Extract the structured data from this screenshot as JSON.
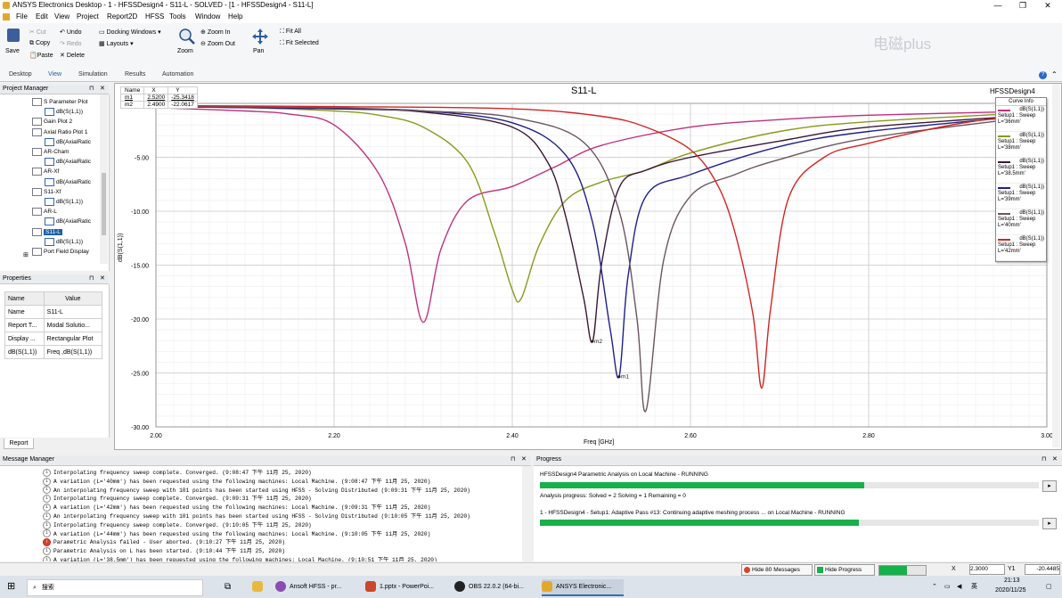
{
  "window": {
    "title": "ANSYS Electronics Desktop - 1 - HFSSDesign4 - S11-L - SOLVED - [1 - HFSSDesign4 - S11-L]"
  },
  "menu": [
    "File",
    "Edit",
    "View",
    "Project",
    "Report2D",
    "HFSS",
    "Tools",
    "Window",
    "Help"
  ],
  "ribbon": {
    "save": "Save",
    "cut": "Cut",
    "copy": "Copy",
    "paste": "Paste",
    "undo": "Undo",
    "redo": "Redo",
    "delete": "Delete",
    "docking": "Docking Windows",
    "layouts": "Layouts",
    "zoom": "Zoom",
    "zoom_in": "Zoom In",
    "zoom_out": "Zoom Out",
    "pan": "Pan",
    "fit_all": "Fit All",
    "fit_selected": "Fit Selected",
    "watermark": "电磁plus"
  },
  "ribbon_tabs": [
    "Desktop",
    "View",
    "Simulation",
    "Results",
    "Automation"
  ],
  "project_manager": {
    "title": "Project Manager",
    "items": [
      {
        "label": "S Parameter Plot",
        "level": 0
      },
      {
        "label": "dB(S(1,1))",
        "level": 1
      },
      {
        "label": "Gain Plot 2",
        "level": 0
      },
      {
        "label": "Axial Ratio Plot 1",
        "level": 0
      },
      {
        "label": "dB(AxialRatic",
        "level": 1
      },
      {
        "label": "AR-Cham",
        "level": 0
      },
      {
        "label": "dB(AxialRatic",
        "level": 1
      },
      {
        "label": "AR-Xf",
        "level": 0
      },
      {
        "label": "dB(AxialRatic",
        "level": 1
      },
      {
        "label": "S11-Xf",
        "level": 0
      },
      {
        "label": "dB(S(1,1))",
        "level": 1
      },
      {
        "label": "AR-L",
        "level": 0
      },
      {
        "label": "dB(AxialRatic",
        "level": 1
      },
      {
        "label": "S11-L",
        "level": 0,
        "selected": true
      },
      {
        "label": "dB(S(1,1))",
        "level": 1
      },
      {
        "label": "Port Field Display",
        "level": 0
      }
    ]
  },
  "properties": {
    "title": "Properties",
    "header": [
      "Name",
      "Value"
    ],
    "rows": [
      [
        "Name",
        "S11-L"
      ],
      [
        "Report T...",
        "Modal Solutio..."
      ],
      [
        "Display ...",
        "Rectangular Plot"
      ],
      [
        "dB(S(1,1))",
        "Freq ,dB(S(1,1))"
      ]
    ],
    "tab": "Report"
  },
  "plot": {
    "title": "S11-L",
    "design": "HFSSDesign4",
    "marker_header": [
      "Name",
      "X",
      "Y"
    ],
    "markers": [
      [
        "m1",
        "2.5200",
        "-25.3418"
      ],
      [
        "m2",
        "2.4900",
        "-22.0617"
      ]
    ],
    "curve_info_title": "Curve Info",
    "legend": [
      {
        "l1": "dB(S(1,1))",
        "l2": "Setup1 : Sweep",
        "l3": "L='36mm'",
        "color": "#c0307f"
      },
      {
        "l1": "dB(S(1,1))",
        "l2": "Setup1 : Sweep",
        "l3": "L='38mm'",
        "color": "#8a9a1a"
      },
      {
        "l1": "dB(S(1,1))",
        "l2": "Setup1 : Sweep",
        "l3": "L='38.5mm'",
        "color": "#3a1836"
      },
      {
        "l1": "dB(S(1,1))",
        "l2": "Setup1 : Sweep",
        "l3": "L='39mm'",
        "color": "#1f1f8c"
      },
      {
        "l1": "dB(S(1,1))",
        "l2": "Setup1 : Sweep",
        "l3": "L='40mm'",
        "color": "#6b5560"
      },
      {
        "l1": "dB(S(1,1))",
        "l2": "Setup1 : Sweep",
        "l3": "L='42mm'",
        "color": "#d42424"
      }
    ]
  },
  "chart_data": {
    "type": "line",
    "title": "S11-L",
    "xlabel": "Freq [GHz]",
    "ylabel": "dB(S(1,1))",
    "xlim": [
      2.0,
      3.0
    ],
    "ylim": [
      -30,
      0
    ],
    "xticks": [
      "2.00",
      "2.20",
      "2.40",
      "2.60",
      "2.80",
      "3.00"
    ],
    "yticks": [
      "-5.00",
      "-10.00",
      "-15.00",
      "-20.00",
      "-25.00",
      "-30.00"
    ],
    "grid": true,
    "series": [
      {
        "name": "L='36mm'",
        "color": "#c0307f",
        "x": [
          2.0,
          2.1,
          2.15,
          2.2,
          2.25,
          2.28,
          2.3,
          2.32,
          2.35,
          2.4,
          2.45,
          2.5,
          2.6,
          2.7,
          2.8,
          3.0
        ],
        "y": [
          -0.4,
          -0.7,
          -1.0,
          -2.0,
          -6.5,
          -13,
          -20.3,
          -13.5,
          -9,
          -7.7,
          -5.8,
          -3.9,
          -2.2,
          -1.5,
          -1.1,
          -0.7
        ]
      },
      {
        "name": "L='38mm'",
        "color": "#8a9a1a",
        "x": [
          2.0,
          2.1,
          2.2,
          2.25,
          2.3,
          2.35,
          2.38,
          2.4,
          2.41,
          2.43,
          2.46,
          2.5,
          2.55,
          2.6,
          2.7,
          2.8,
          3.0
        ],
        "y": [
          -0.3,
          -0.4,
          -0.7,
          -1.1,
          -2.2,
          -5.5,
          -12,
          -17.3,
          -18.1,
          -13.2,
          -9,
          -7.3,
          -6.2,
          -4.6,
          -2.6,
          -1.7,
          -0.8
        ]
      },
      {
        "name": "L='38.5mm'",
        "color": "#3a1836",
        "x": [
          2.0,
          2.2,
          2.3,
          2.4,
          2.44,
          2.46,
          2.48,
          2.49,
          2.5,
          2.52,
          2.55,
          2.6,
          2.7,
          2.8,
          3.0
        ],
        "y": [
          -0.3,
          -0.5,
          -0.8,
          -2.2,
          -5.5,
          -10.5,
          -18,
          -22.1,
          -15,
          -7.8,
          -6.2,
          -5,
          -3.5,
          -2.2,
          -1
        ]
      },
      {
        "name": "L='39mm'",
        "color": "#1f1f8c",
        "x": [
          2.0,
          2.2,
          2.3,
          2.4,
          2.46,
          2.49,
          2.51,
          2.52,
          2.53,
          2.55,
          2.6,
          2.7,
          2.8,
          3.0
        ],
        "y": [
          -0.3,
          -0.5,
          -0.7,
          -1.8,
          -4.8,
          -11,
          -21,
          -25.3,
          -16,
          -8.6,
          -6.6,
          -4,
          -2.6,
          -1
        ]
      },
      {
        "name": "L='40mm'",
        "color": "#6b5560",
        "x": [
          2.0,
          2.2,
          2.3,
          2.4,
          2.48,
          2.52,
          2.54,
          2.55,
          2.57,
          2.6,
          2.65,
          2.7,
          2.8,
          3.0
        ],
        "y": [
          -0.3,
          -0.4,
          -0.7,
          -1.3,
          -3.6,
          -10,
          -20,
          -28.5,
          -14.5,
          -8.6,
          -6.6,
          -5.2,
          -3.2,
          -1.1
        ]
      },
      {
        "name": "L='42mm'",
        "color": "#d42424",
        "x": [
          2.0,
          2.2,
          2.4,
          2.5,
          2.55,
          2.6,
          2.63,
          2.65,
          2.67,
          2.68,
          2.69,
          2.71,
          2.75,
          2.8,
          2.9,
          3.0
        ],
        "y": [
          -0.2,
          -0.3,
          -0.5,
          -1.2,
          -2.2,
          -4.3,
          -7.5,
          -12,
          -19.5,
          -26.4,
          -19,
          -8.8,
          -5,
          -3.7,
          -1.9,
          -0.8
        ]
      }
    ],
    "markers": [
      {
        "name": "m1",
        "x": 2.52,
        "y": -25.3418
      },
      {
        "name": "m2",
        "x": 2.49,
        "y": -22.0617
      }
    ]
  },
  "message_manager": {
    "title": "Message Manager",
    "messages": [
      {
        "type": "info",
        "text": "Interpolating frequency sweep complete. Converged. (9:08:47 下午  11月 25, 2020)"
      },
      {
        "type": "info",
        "text": "A variation (L='40mm') has been requested using the following machines: Local Machine. (9:08:47 下午  11月 25, 2020)"
      },
      {
        "type": "info",
        "text": "An interpolating frequency sweep with 101 points has been started using HFSS - Solving Distributed  (9:09:31 下午  11月 25, 2020)"
      },
      {
        "type": "info",
        "text": "Interpolating frequency sweep complete. Converged. (9:09:31 下午  11月 25, 2020)"
      },
      {
        "type": "info",
        "text": "A variation (L='42mm') has been requested using the following machines: Local Machine. (9:09:31 下午  11月 25, 2020)"
      },
      {
        "type": "info",
        "text": "An interpolating frequency sweep with 101 points has been started using HFSS - Solving Distributed  (9:10:05 下午  11月 25, 2020)"
      },
      {
        "type": "info",
        "text": "Interpolating frequency sweep complete. Converged. (9:10:05 下午  11月 25, 2020)"
      },
      {
        "type": "info",
        "text": "A variation (L='44mm') has been requested using the following machines: Local Machine. (9:10:05 下午  11月 25, 2020)"
      },
      {
        "type": "error",
        "text": "Parametric Analysis failed - User aborted. (9:10:27 下午  11月 25, 2020)"
      },
      {
        "type": "info",
        "text": "Parametric Analysis on L has been started. (9:10:44 下午  11月 25, 2020)"
      },
      {
        "type": "info",
        "text": "A variation (L='38.5mm') has been requested using the following machines: Local Machine. (9:10:51 下午  11月 25, 2020)"
      }
    ]
  },
  "progress": {
    "title": "Progress",
    "line1": "HFSSDesign4 Parametric Analysis on Local Machine - RUNNING",
    "bar1": 0.65,
    "analysis_status": "Analysis progress:   Solved = 2   Solving = 1   Remaining = 0",
    "line2": "1 - HFSSDesign4 - Setup1: Adaptive Pass #13: Continuing adaptive meshing process ... on Local Machine - RUNNING",
    "bar2": 0.64
  },
  "statusbar": {
    "hide_messages": "Hide 80 Messages",
    "hide_progress": "Hide Progress",
    "x_label": "X",
    "x_value": "2.3000",
    "y_label": "Y1",
    "y_value": "-20.4485",
    "status_progress": 0.6
  },
  "taskbar": {
    "search": "搜索",
    "apps": [
      "Ansoft HFSS - pr...",
      "1.pptx - PowerPoi...",
      "OBS 22.0.2 (64-bi...",
      "ANSYS Electronic..."
    ],
    "ime": "英",
    "time": "21:13",
    "date": "2020/11/25"
  }
}
